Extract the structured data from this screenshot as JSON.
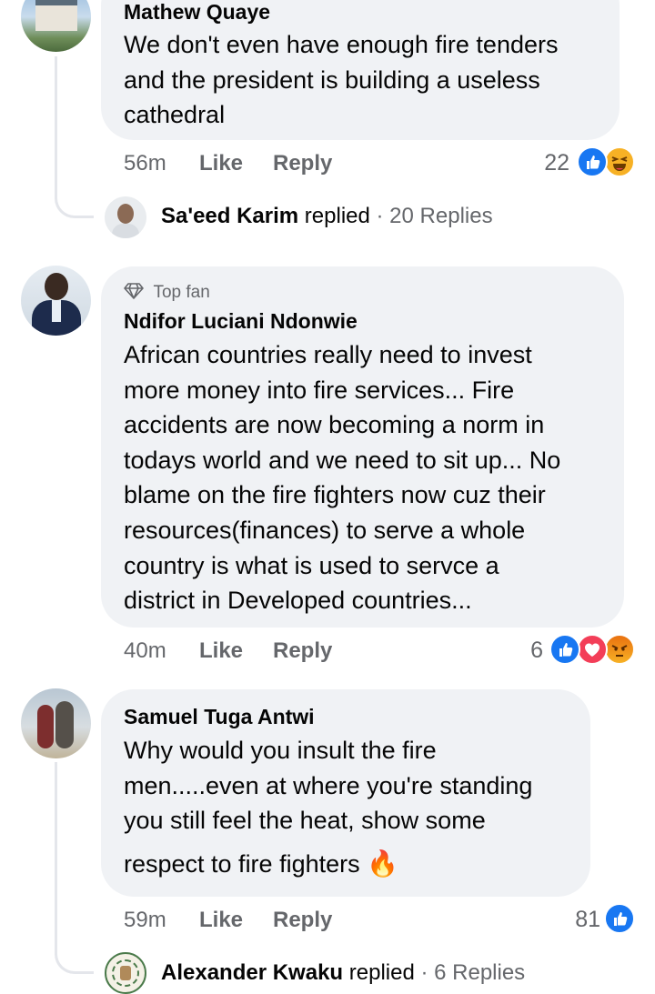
{
  "comments": [
    {
      "author": "Mathew Quaye",
      "text_lines": [
        "We don't even have enough fire tenders",
        "and the president is building a useless",
        "cathedral"
      ],
      "time": "56m",
      "like_label": "Like",
      "reply_label": "Reply",
      "reaction_count": "22",
      "reactions": [
        "like-icon",
        "haha-icon"
      ],
      "replies": {
        "author": "Sa'eed Karim",
        "verb": "replied",
        "count_text": "· 20 Replies"
      }
    },
    {
      "badge": "Top fan",
      "author": "Ndifor Luciani Ndonwie",
      "text_lines": [
        "African countries really need to invest",
        "more money into fire services... Fire",
        "accidents are now becoming a norm in",
        "todays world and we need to sit up... No",
        "blame on the fire fighters now cuz their",
        "resources(finances) to serve a whole",
        "country is what is used to servce a",
        "district in Developed countries..."
      ],
      "time": "40m",
      "like_label": "Like",
      "reply_label": "Reply",
      "reaction_count": "6",
      "reactions": [
        "like-icon",
        "love-icon",
        "angry-icon"
      ]
    },
    {
      "author": "Samuel Tuga Antwi",
      "text_lines": [
        "Why would you insult the fire",
        "men.....even at where you're standing",
        "you still feel the heat, show some",
        "respect to fire fighters"
      ],
      "emoji": "🔥",
      "time": "59m",
      "like_label": "Like",
      "reply_label": "Reply",
      "reaction_count": "81",
      "reactions": [
        "like-icon"
      ],
      "replies": {
        "author": "Alexander Kwaku",
        "verb": "replied",
        "count_text": "· 6 Replies"
      }
    }
  ],
  "colors": {
    "bubble": "#f0f2f5",
    "like": "#1877f2",
    "love": "#f33e58",
    "haha": "#f7b125",
    "meta": "#65676b"
  }
}
